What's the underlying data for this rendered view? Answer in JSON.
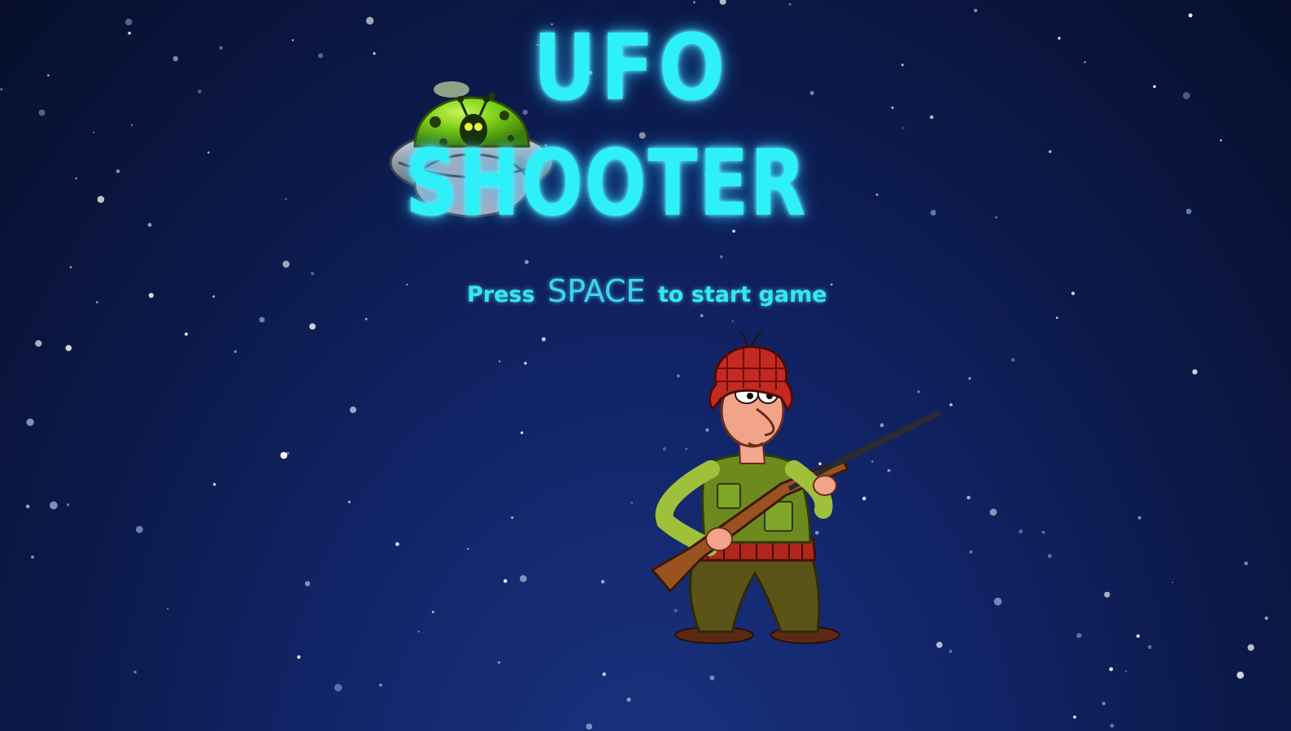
{
  "title": {
    "line1": "UFO",
    "line2": "SHOOTER"
  },
  "prompt": {
    "before": "Press",
    "key": "SPACE",
    "after": "to start game"
  },
  "sprites": {
    "ufo": "ufo-alien-icon",
    "player": "hunter-with-rifle"
  },
  "colors": {
    "title_glow": "#2ef0f8",
    "background_top": "#070f2c",
    "background_bottom": "#1a3480",
    "ufo_dome": "#7fd11a"
  }
}
